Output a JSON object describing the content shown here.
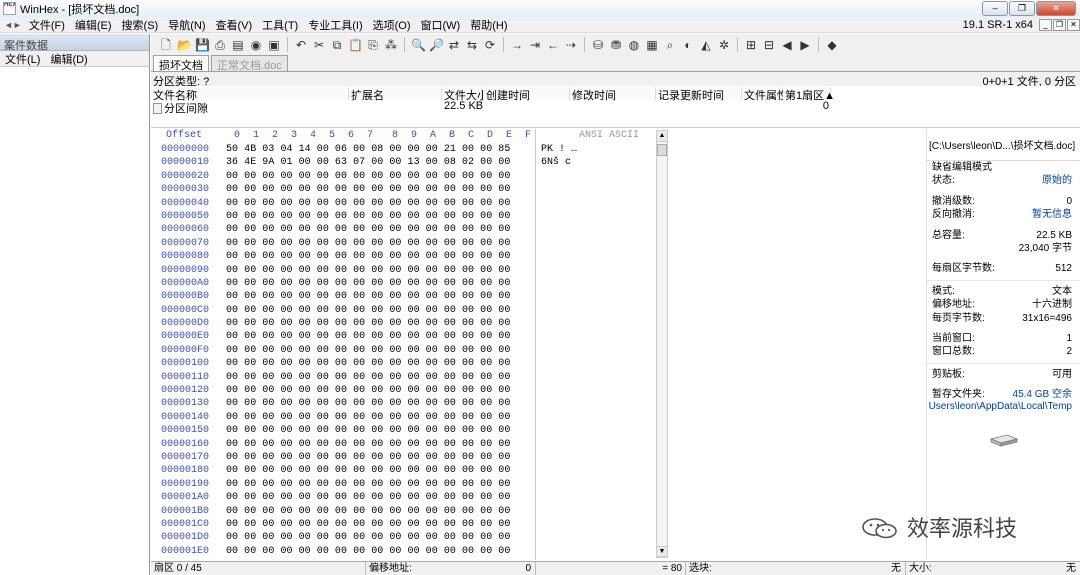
{
  "window": {
    "title": "WinHex - [损坏文档.doc]",
    "icon_text": "HEX",
    "buttons": [
      "‒",
      "❐",
      "✕"
    ]
  },
  "menu": {
    "items": [
      "文件(F)",
      "编辑(E)",
      "搜索(S)",
      "导航(N)",
      "查看(V)",
      "工具(T)",
      "专业工具(I)",
      "选项(O)",
      "窗口(W)",
      "帮助(H)"
    ],
    "version": "19.1 SR-1 x64",
    "mdi_buttons": [
      "_",
      "❐",
      "✕"
    ]
  },
  "case_panel": {
    "title": "案件数据",
    "menu": [
      "文件(L)",
      "编辑(D)"
    ]
  },
  "tabs": [
    {
      "label": "损坏文档",
      "active": true
    },
    {
      "label": "正常文档.doc",
      "active": false
    }
  ],
  "partition": {
    "label": "分区类型: ?",
    "summary": "0+0+1 文件, 0 分区"
  },
  "file_list": {
    "headers": [
      "文件名称",
      "扩展名",
      "文件大小",
      "创建时间",
      "修改时间",
      "记录更新时间",
      "文件属性",
      "第1扇区▲"
    ],
    "row": {
      "name": "分区间隙",
      "ext": "",
      "size": "22.5 KB",
      "created": "",
      "modified": "",
      "updated": "",
      "attr": "",
      "sector": "0"
    }
  },
  "hex": {
    "offset_label": "Offset",
    "columns": [
      "0",
      "1",
      "2",
      "3",
      "4",
      "5",
      "6",
      "7",
      "8",
      "9",
      "A",
      "B",
      "C",
      "D",
      "E",
      "F"
    ],
    "ansi_label": "ANSI ASCII",
    "rows": [
      {
        "offset": "00000000",
        "hex": "50 4B 03 04 14 00 06 00  08 00 00 00 21 00 00 85",
        "ascii": "PK          !  …"
      },
      {
        "offset": "00000010",
        "hex": "36 4E 9A 01 00 00 63 07  00 00 13 00 08 02 00 00",
        "ascii": "6Nš   c"
      },
      {
        "offset": "00000020",
        "hex": "00 00 00 00 00 00 00 00  00 00 00 00 00 00 00 00",
        "ascii": ""
      },
      {
        "offset": "00000030",
        "hex": "00 00 00 00 00 00 00 00  00 00 00 00 00 00 00 00",
        "ascii": ""
      },
      {
        "offset": "00000040",
        "hex": "00 00 00 00 00 00 00 00  00 00 00 00 00 00 00 00",
        "ascii": ""
      },
      {
        "offset": "00000050",
        "hex": "00 00 00 00 00 00 00 00  00 00 00 00 00 00 00 00",
        "ascii": ""
      },
      {
        "offset": "00000060",
        "hex": "00 00 00 00 00 00 00 00  00 00 00 00 00 00 00 00",
        "ascii": ""
      },
      {
        "offset": "00000070",
        "hex": "00 00 00 00 00 00 00 00  00 00 00 00 00 00 00 00",
        "ascii": ""
      },
      {
        "offset": "00000080",
        "hex": "00 00 00 00 00 00 00 00  00 00 00 00 00 00 00 00",
        "ascii": ""
      },
      {
        "offset": "00000090",
        "hex": "00 00 00 00 00 00 00 00  00 00 00 00 00 00 00 00",
        "ascii": ""
      },
      {
        "offset": "000000A0",
        "hex": "00 00 00 00 00 00 00 00  00 00 00 00 00 00 00 00",
        "ascii": ""
      },
      {
        "offset": "000000B0",
        "hex": "00 00 00 00 00 00 00 00  00 00 00 00 00 00 00 00",
        "ascii": ""
      },
      {
        "offset": "000000C0",
        "hex": "00 00 00 00 00 00 00 00  00 00 00 00 00 00 00 00",
        "ascii": ""
      },
      {
        "offset": "000000D0",
        "hex": "00 00 00 00 00 00 00 00  00 00 00 00 00 00 00 00",
        "ascii": ""
      },
      {
        "offset": "000000E0",
        "hex": "00 00 00 00 00 00 00 00  00 00 00 00 00 00 00 00",
        "ascii": ""
      },
      {
        "offset": "000000F0",
        "hex": "00 00 00 00 00 00 00 00  00 00 00 00 00 00 00 00",
        "ascii": ""
      },
      {
        "offset": "00000100",
        "hex": "00 00 00 00 00 00 00 00  00 00 00 00 00 00 00 00",
        "ascii": ""
      },
      {
        "offset": "00000110",
        "hex": "00 00 00 00 00 00 00 00  00 00 00 00 00 00 00 00",
        "ascii": ""
      },
      {
        "offset": "00000120",
        "hex": "00 00 00 00 00 00 00 00  00 00 00 00 00 00 00 00",
        "ascii": ""
      },
      {
        "offset": "00000130",
        "hex": "00 00 00 00 00 00 00 00  00 00 00 00 00 00 00 00",
        "ascii": ""
      },
      {
        "offset": "00000140",
        "hex": "00 00 00 00 00 00 00 00  00 00 00 00 00 00 00 00",
        "ascii": ""
      },
      {
        "offset": "00000150",
        "hex": "00 00 00 00 00 00 00 00  00 00 00 00 00 00 00 00",
        "ascii": ""
      },
      {
        "offset": "00000160",
        "hex": "00 00 00 00 00 00 00 00  00 00 00 00 00 00 00 00",
        "ascii": ""
      },
      {
        "offset": "00000170",
        "hex": "00 00 00 00 00 00 00 00  00 00 00 00 00 00 00 00",
        "ascii": ""
      },
      {
        "offset": "00000180",
        "hex": "00 00 00 00 00 00 00 00  00 00 00 00 00 00 00 00",
        "ascii": ""
      },
      {
        "offset": "00000190",
        "hex": "00 00 00 00 00 00 00 00  00 00 00 00 00 00 00 00",
        "ascii": ""
      },
      {
        "offset": "000001A0",
        "hex": "00 00 00 00 00 00 00 00  00 00 00 00 00 00 00 00",
        "ascii": ""
      },
      {
        "offset": "000001B0",
        "hex": "00 00 00 00 00 00 00 00  00 00 00 00 00 00 00 00",
        "ascii": ""
      },
      {
        "offset": "000001C0",
        "hex": "00 00 00 00 00 00 00 00  00 00 00 00 00 00 00 00",
        "ascii": ""
      },
      {
        "offset": "000001D0",
        "hex": "00 00 00 00 00 00 00 00  00 00 00 00 00 00 00 00",
        "ascii": ""
      },
      {
        "offset": "000001E0",
        "hex": "00 00 00 00 00 00 00 00  00 00 00 00 00 00 00 00",
        "ascii": ""
      }
    ]
  },
  "info_panel": {
    "path": "[C:\\Users\\leon\\D...\\损坏文档.doc]",
    "rows": [
      {
        "label": "缺省编辑模式",
        "value": ""
      },
      {
        "label": "状态:",
        "value": "原始的"
      },
      {
        "blank": true
      },
      {
        "label": "撤消级数:",
        "value": "0"
      },
      {
        "label": "反向撤消:",
        "value": "暂无信息"
      },
      {
        "blank": true
      },
      {
        "label": "总容量:",
        "value": "22.5 KB"
      },
      {
        "label": "",
        "value": "23,040 字节"
      },
      {
        "blank": true
      },
      {
        "label": "每扇区字节数:",
        "value": "512"
      },
      {
        "sep": true
      },
      {
        "label": "模式:",
        "value": "文本"
      },
      {
        "label": "偏移地址:",
        "value": "十六进制"
      },
      {
        "label": "每页字节数:",
        "value": "31x16=496"
      },
      {
        "blank": true
      },
      {
        "label": "当前窗口:",
        "value": "1"
      },
      {
        "label": "窗口总数:",
        "value": "2"
      },
      {
        "sep": true
      },
      {
        "label": "剪贴板:",
        "value": "可用"
      },
      {
        "blank": true
      },
      {
        "label": "暂存文件夹:",
        "value": "45.4 GB 空余"
      }
    ],
    "temp_path": "Users\\leon\\AppData\\Local\\Temp"
  },
  "status_bar": {
    "sector": "扇区 0 / 45",
    "offset_label": "偏移地址:",
    "offset_value": "0",
    "eq": "= 80",
    "selection_label": "选块:",
    "selection_value": "无",
    "size_label": "大小:",
    "size_value": "无"
  },
  "watermark": "效率源科技"
}
